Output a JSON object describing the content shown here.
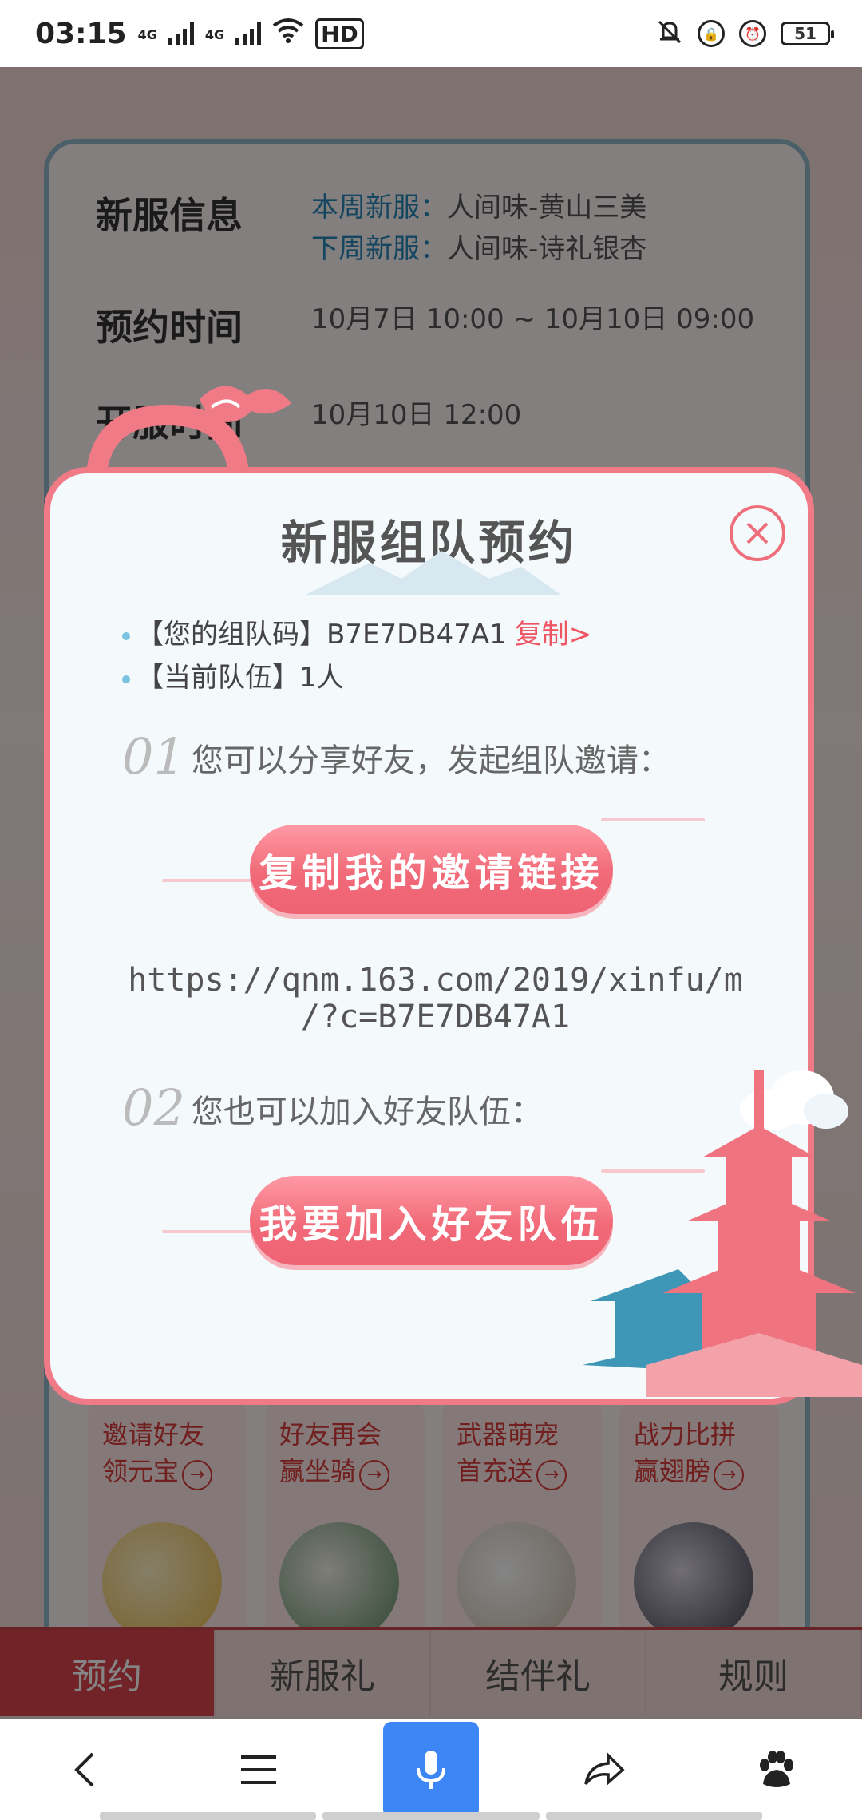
{
  "status_bar": {
    "time": "03:15",
    "network1": "4G",
    "network2": "4G",
    "hd_label": "HD",
    "battery": "51"
  },
  "background": {
    "info": [
      {
        "title": "新服信息",
        "lines": [
          {
            "label": "本周新服：",
            "value": "人间味-黄山三美"
          },
          {
            "label": "下周新服：",
            "value": "人间味-诗礼银杏"
          }
        ]
      },
      {
        "title": "预约时间",
        "text": "10月7日 10:00 ~ 10月10日 09:00"
      },
      {
        "title": "开服时间",
        "text": "10月10日 12:00"
      }
    ],
    "cards": [
      {
        "line1": "邀请好友",
        "line2": "领元宝"
      },
      {
        "line1": "好友再会",
        "line2": "赢坐骑"
      },
      {
        "line1": "武器萌宠",
        "line2": "首充送"
      },
      {
        "line1": "战力比拼",
        "line2": "赢翅膀"
      }
    ],
    "tabs": [
      "预约",
      "新服礼",
      "结伴礼",
      "规则"
    ]
  },
  "modal": {
    "title": "新服组队预约",
    "team_code_label": "【您的组队码】B7E7DB47A1",
    "copy_label": "复制>",
    "current_team_label": "【当前队伍】1人",
    "step1_num": "01",
    "step1_text": "您可以分享好友，发起组队邀请：",
    "copy_invite_button": "复制我的邀请链接",
    "invite_url_line1": "https://qnm.163.com/2019/xinfu/m",
    "invite_url_line2": "/?c=B7E7DB47A1",
    "step2_num": "02",
    "step2_text": "您也可以加入好友队伍：",
    "join_team_button": "我要加入好友队伍"
  },
  "bottom_nav": {
    "items": [
      "back-icon",
      "menu-icon",
      "microphone-icon",
      "share-icon",
      "baidu-paw-icon"
    ]
  },
  "colors": {
    "accent": "#ef6375",
    "modal_border": "#f07b86",
    "highlight_blue": "#2a87b8",
    "mic_blue": "#3d86f5"
  }
}
